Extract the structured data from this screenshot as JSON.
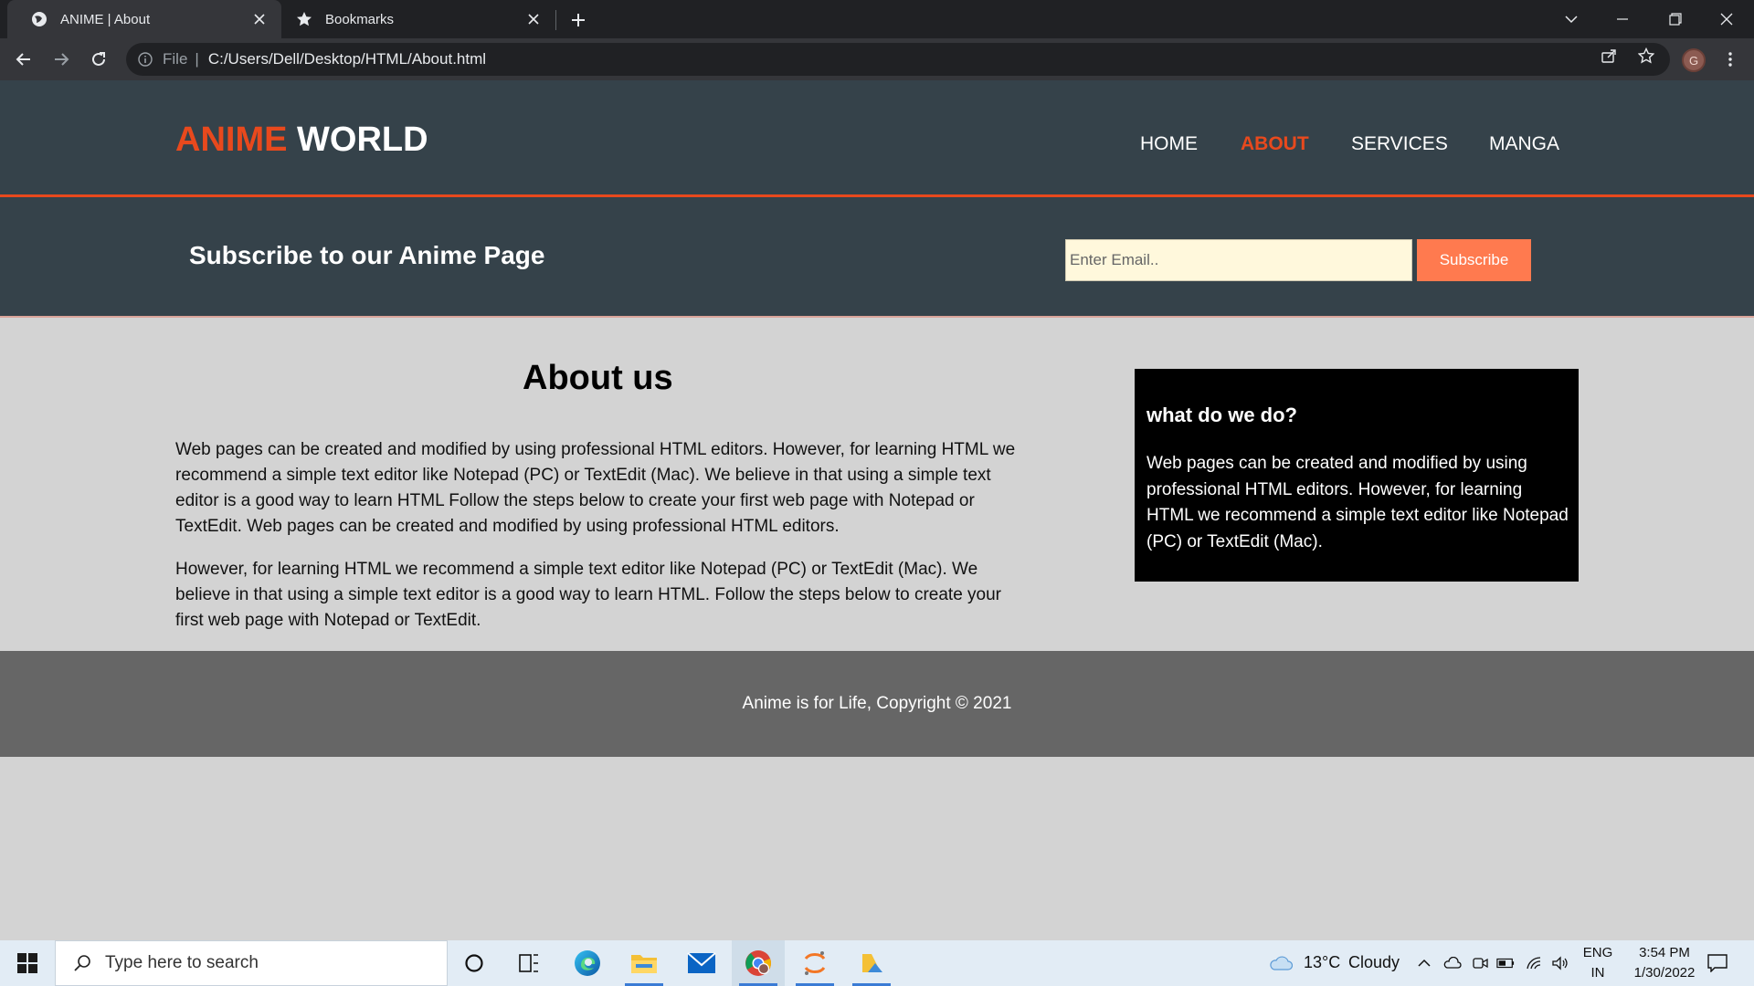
{
  "browser": {
    "tabs": [
      {
        "title": "ANIME | About",
        "icon": "globe-icon",
        "active": true
      },
      {
        "title": "Bookmarks",
        "icon": "star-icon",
        "active": false
      }
    ],
    "address": {
      "scheme_label": "File",
      "url": "C:/Users/Dell/Desktop/HTML/About.html"
    },
    "profile_initial": "G"
  },
  "site": {
    "logo": {
      "highlight": "ANIME",
      "rest": "WORLD"
    },
    "nav": [
      {
        "label": "HOME",
        "current": false
      },
      {
        "label": "ABOUT",
        "current": true
      },
      {
        "label": "SERVICES",
        "current": false
      },
      {
        "label": "MANGA",
        "current": false
      }
    ],
    "subscribe": {
      "title": "Subscribe to our Anime Page",
      "email_placeholder": "Enter Email..",
      "email_value": "",
      "button_label": "Subscribe"
    },
    "about": {
      "title": "About us",
      "paragraphs": [
        "Web pages can be created and modified by using professional HTML editors. However, for learning HTML we recommend a simple text editor like Notepad (PC) or TextEdit (Mac). We believe in that using a simple text editor is a good way to learn HTML Follow the steps below to create your first web page with Notepad or TextEdit. Web pages can be created and modified by using professional HTML editors.",
        "However, for learning HTML we recommend a simple text editor like Notepad (PC) or TextEdit (Mac). We believe in that using a simple text editor is a good way to learn HTML. Follow the steps below to create your first web page with Notepad or TextEdit."
      ]
    },
    "sidebar": {
      "heading": "what do we do?",
      "text": "Web pages can be created and modified by using professional HTML editors. However, for learning HTML we recommend a simple text editor like Notepad (PC) or TextEdit (Mac)."
    },
    "footer": {
      "text": "Anime is for Life, Copyright © 2021"
    }
  },
  "taskbar": {
    "search_placeholder": "Type here to search",
    "apps": [
      "cortana-icon",
      "task-view-icon",
      "edge-icon",
      "file-explorer-icon",
      "mail-icon",
      "chrome-icon",
      "jupyter-icon",
      "photos-icon"
    ],
    "weather": {
      "temp": "13°C",
      "condition": "Cloudy"
    },
    "language": {
      "lang": "ENG",
      "region": "IN"
    },
    "clock": {
      "time": "3:54 PM",
      "date": "1/30/2022"
    }
  },
  "colors": {
    "accent": "#e8491d",
    "header_bg": "#35424a",
    "page_bg": "#d3d3d3",
    "footer_bg": "#666666",
    "button_bg": "#ff7a4f",
    "input_bg": "#fff8dc"
  }
}
